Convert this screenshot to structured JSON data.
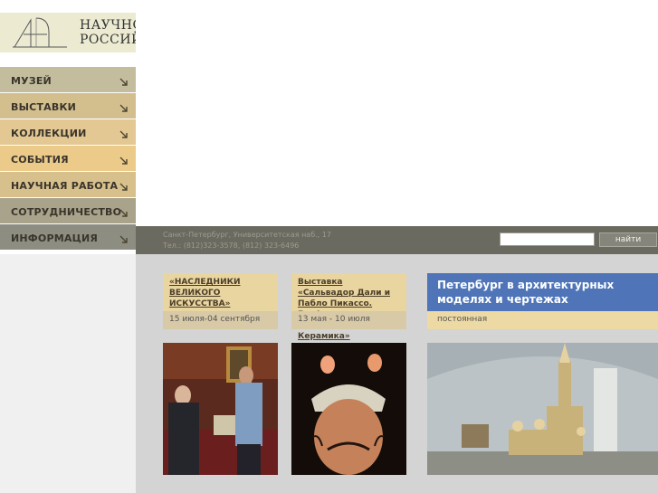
{
  "logo": {
    "line1": "НАУЧНО",
    "line2": "РОССИЙ"
  },
  "sidebar": {
    "items": [
      {
        "label": "МУЗЕЙ",
        "color": "#c3bd9d"
      },
      {
        "label": "ВЫСТАВКИ",
        "color": "#d3bf8e"
      },
      {
        "label": "КОЛЛЕКЦИИ",
        "color": "#e4c893"
      },
      {
        "label": "СОБЫТИЯ",
        "color": "#ecca8a"
      },
      {
        "label": "НАУЧНАЯ РАБОТА",
        "color": "#d8c08d"
      },
      {
        "label": "СОТРУДНИЧЕСТВО",
        "color": "#a9a38b"
      },
      {
        "label": "ИНФОРМАЦИЯ",
        "color": "#8e8d82"
      }
    ]
  },
  "header": {
    "address": "Санкт-Петербург, Университетская наб., 17",
    "phones": "Тел.: (812)323-3578, (812) 323-6496"
  },
  "search": {
    "placeholder": "",
    "button_label": "найти"
  },
  "exhibitions": [
    {
      "title": "«НАСЛЕДНИКИ ВЕЛИКОГО ИСКУССТВА»",
      "dates": "15 июля-04 сентября",
      "image": "photo-award-ceremony"
    },
    {
      "title": "Выставка «Сальвадор Дали и Пабло Пикассо. Графика. Скульптура. Керамика»",
      "dates": "13 мая - 10 июля",
      "image": "photo-salvador-dali"
    },
    {
      "title": "Петербург в архитектурных моделях и чертежах",
      "dates": "постоянная",
      "image": "photo-cathedral-model"
    }
  ],
  "colors": {
    "topbar": "#6b6a60",
    "content_bg": "#d3d4d3",
    "featured_title_bg": "#4f75b8",
    "featured_date_bg": "#ecd9a4"
  }
}
